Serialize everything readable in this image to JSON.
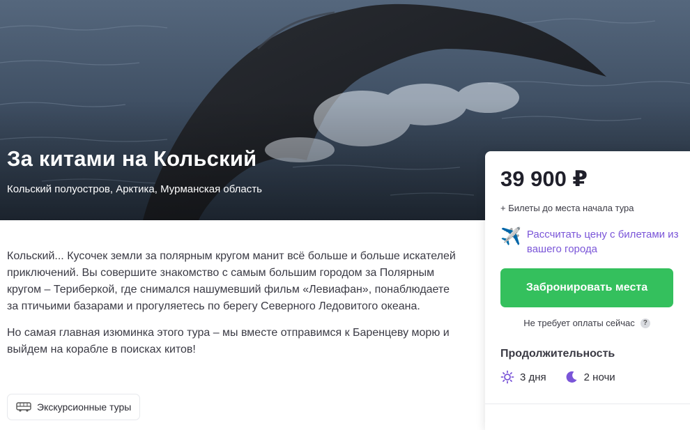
{
  "tour": {
    "title": "За китами на Кольский",
    "location": "Кольский полуостров, Арктика, Мурманская область"
  },
  "description": {
    "paragraphs": [
      "Кольский... Кусочек земли за полярным кругом манит всё больше и больше искателей приключений. Вы совершите знакомство с самым большим городом за Полярным кругом – Териберкой, где снимался нашумевший фильм «Левиафан», понаблюдаете за птичьими базарами и прогуляетесь по берегу Северного Ледовитого океана.",
      "Но самая главная изюминка этого тура – мы вместе отправимся к Баренцеву морю и выйдем на корабле в поисках китов!"
    ]
  },
  "tag": {
    "label": "Экскурсионные туры",
    "icon": "bus-icon"
  },
  "booking": {
    "price": "39 900 ₽",
    "price_note": "+ Билеты до места начала тура",
    "calc_link": "Рассчитать цену с билетами из вашего города",
    "calc_icon": "airplane-icon",
    "book_button": "Забронировать места",
    "no_payment": "Не требует оплаты сейчас",
    "help_symbol": "?",
    "duration_title": "Продолжительность",
    "days": "3 дня",
    "nights": "2 ночи"
  },
  "colors": {
    "accent_purple": "#7a55d8",
    "button_green": "#34c05d",
    "text_dark": "#1f1f2a"
  }
}
